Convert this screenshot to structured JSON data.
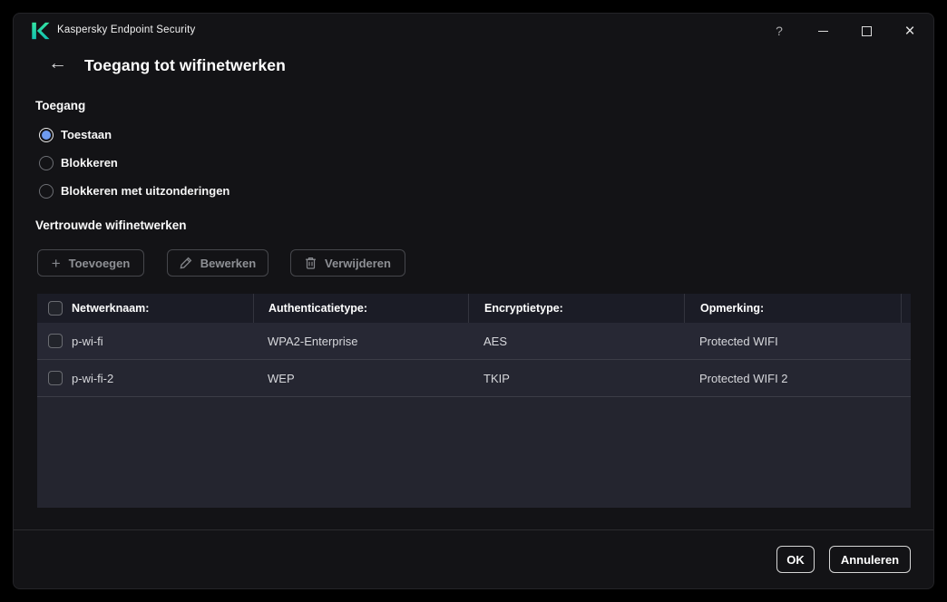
{
  "colors": {
    "brand_teal": "#25d9a6",
    "accent_blue": "#6e9bef",
    "table_panel": "#252631",
    "window_bg": "#131316"
  },
  "titlebar": {
    "app_title": "Kaspersky Endpoint Security",
    "help_glyph": "?",
    "close_glyph": "×"
  },
  "header": {
    "back_glyph": "←",
    "title": "Toegang tot wifinetwerken"
  },
  "access": {
    "label": "Toegang",
    "options": [
      {
        "label": "Toestaan",
        "selected": true
      },
      {
        "label": "Blokkeren",
        "selected": false
      },
      {
        "label": "Blokkeren met uitzonderingen",
        "selected": false
      }
    ]
  },
  "trusted": {
    "label": "Vertrouwde wifinetwerken",
    "toolbar": {
      "add_glyph": "+",
      "add_label": "Toevoegen",
      "edit_label": "Bewerken",
      "delete_label": "Verwijderen"
    },
    "table": {
      "columns": [
        "Netwerknaam:",
        "Authenticatietype:",
        "Encryptietype:",
        "Opmerking:"
      ],
      "rows": [
        {
          "network": "p-wi-fi",
          "auth_type": "WPA2-Enterprise",
          "encryption": "AES",
          "comment": "Protected WIFI"
        },
        {
          "network": "p-wi-fi-2",
          "auth_type": "WEP",
          "encryption": "TKIP",
          "comment": "Protected WIFI 2"
        }
      ]
    }
  },
  "footer": {
    "ok_label": "OK",
    "cancel_label": "Annuleren"
  }
}
